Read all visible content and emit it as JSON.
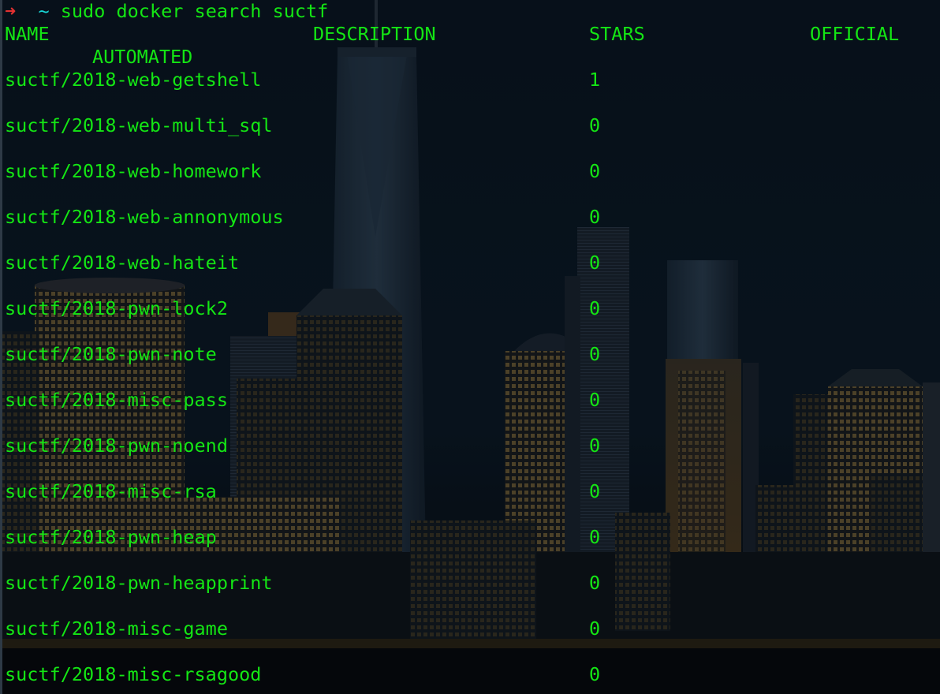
{
  "prompt": {
    "arrow": "➜",
    "cwd": "~",
    "command": "sudo docker search suctf"
  },
  "headers": {
    "name": "NAME",
    "description": "DESCRIPTION",
    "stars": "STARS",
    "official": "OFFICIAL",
    "automated": "AUTOMATED"
  },
  "rows": [
    {
      "name": "suctf/2018-web-getshell",
      "stars": "1"
    },
    {
      "name": "suctf/2018-web-multi_sql",
      "stars": "0"
    },
    {
      "name": "suctf/2018-web-homework",
      "stars": "0"
    },
    {
      "name": "suctf/2018-web-annonymous",
      "stars": "0"
    },
    {
      "name": "suctf/2018-web-hateit",
      "stars": "0"
    },
    {
      "name": "suctf/2018-pwn-lock2",
      "stars": "0"
    },
    {
      "name": "suctf/2018-pwn-note",
      "stars": "0"
    },
    {
      "name": "suctf/2018-misc-pass",
      "stars": "0"
    },
    {
      "name": "suctf/2018-pwn-noend",
      "stars": "0"
    },
    {
      "name": "suctf/2018-misc-rsa",
      "stars": "0"
    },
    {
      "name": "suctf/2018-pwn-heap",
      "stars": "0"
    },
    {
      "name": "suctf/2018-pwn-heapprint",
      "stars": "0"
    },
    {
      "name": "suctf/2018-misc-game",
      "stars": "0"
    },
    {
      "name": "suctf/2018-misc-rsagood",
      "stars": "0"
    }
  ],
  "colors": {
    "text": "#14e614",
    "prompt_arrow": "#e33131",
    "prompt_tilde": "#18d4d4",
    "background": "#07101b"
  }
}
